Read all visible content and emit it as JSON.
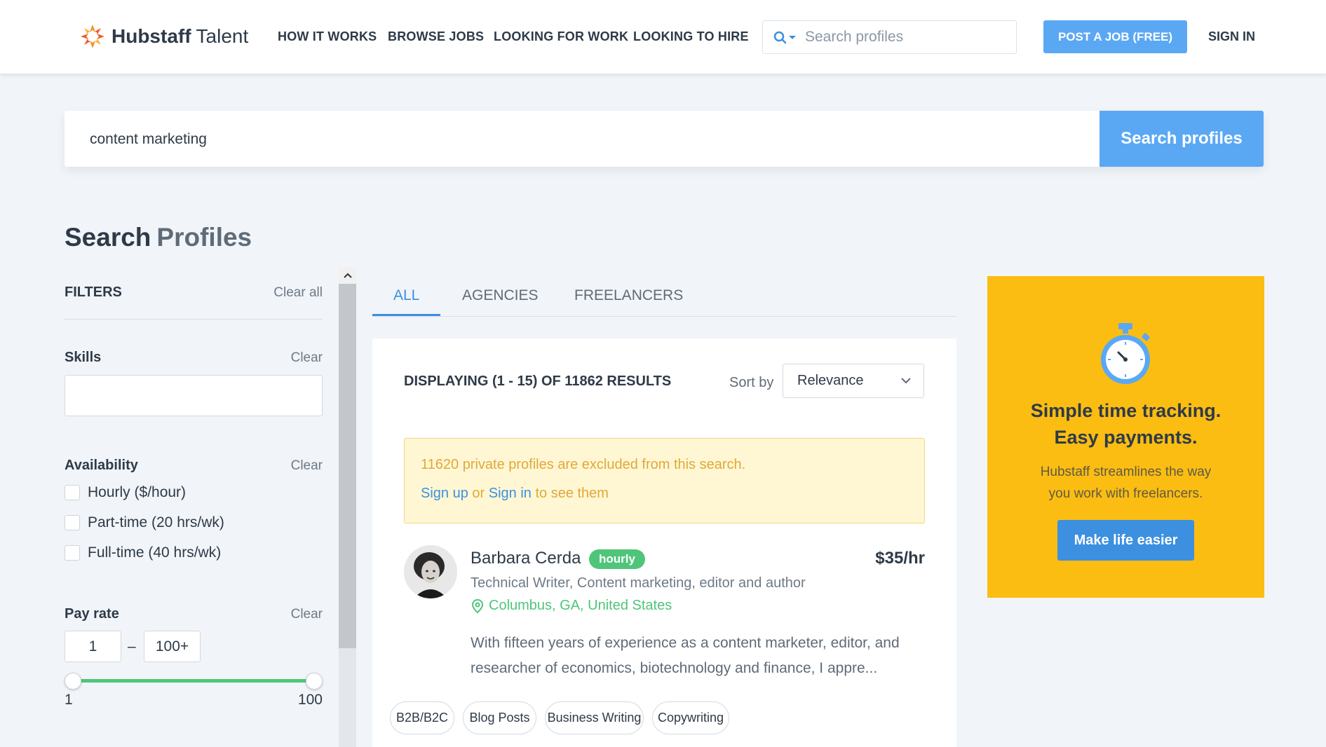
{
  "header": {
    "logo_bold": "Hubstaff",
    "logo_light": "Talent",
    "nav": [
      "HOW IT WORKS",
      "BROWSE JOBS",
      "LOOKING FOR WORK",
      "LOOKING TO HIRE"
    ],
    "search_placeholder": "Search profiles",
    "post_job": "POST A JOB (FREE)",
    "sign_in": "SIGN IN"
  },
  "main_search": {
    "value": "content marketing",
    "button": "Search profiles"
  },
  "page_title": {
    "bold": "Search",
    "light": "Profiles"
  },
  "filters": {
    "title": "FILTERS",
    "clear_all": "Clear all",
    "skills": {
      "label": "Skills",
      "clear": "Clear",
      "value": ""
    },
    "availability": {
      "label": "Availability",
      "clear": "Clear",
      "options": [
        "Hourly ($/hour)",
        "Part-time (20 hrs/wk)",
        "Full-time (40 hrs/wk)"
      ]
    },
    "pay_rate": {
      "label": "Pay rate",
      "clear": "Clear",
      "min": "1",
      "dash": "–",
      "max": "100+",
      "slider_min": "1",
      "slider_max": "100",
      "range": [
        1,
        100
      ]
    }
  },
  "tabs": [
    "ALL",
    "AGENCIES",
    "FREELANCERS"
  ],
  "results": {
    "displaying": "DISPLAYING (1 - 15) OF 11862 RESULTS",
    "sort_label": "Sort by",
    "sort_value": "Relevance",
    "notice": {
      "line1": "11620 private profiles are excluded from this search.",
      "sign_up": "Sign up",
      "or": " or ",
      "sign_in": "Sign in",
      "rest": " to see them"
    },
    "profiles": [
      {
        "name": "Barbara Cerda",
        "badge": "hourly",
        "rate": "$35/hr",
        "title": "Technical Writer, Content marketing, editor and author",
        "location": "Columbus, GA, United States",
        "description": "With fifteen years of experience as a content marketer, editor, and researcher of economics, biotechnology and finance, I appre...",
        "tags": [
          "B2B/B2C",
          "Blog Posts",
          "Business Writing",
          "Copywriting"
        ]
      }
    ]
  },
  "promo": {
    "headline_1": "Simple time tracking.",
    "headline_2": "Easy payments.",
    "text_1": "Hubstaff streamlines the way",
    "text_2": "you work with freelancers.",
    "button": "Make life easier"
  },
  "colors": {
    "accent_blue": "#5aa8f4",
    "link_blue": "#3d8fe0",
    "green": "#4fc57a",
    "promo_yellow": "#fcbd12",
    "logo_orange": "#f7901e"
  }
}
